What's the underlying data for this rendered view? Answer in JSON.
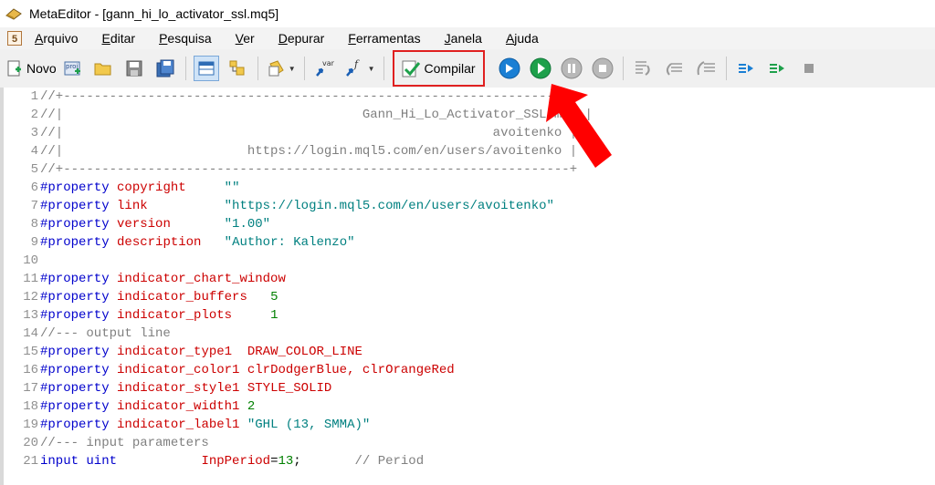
{
  "window": {
    "title": "MetaEditor - [gann_hi_lo_activator_ssl.mq5]"
  },
  "menu": [
    {
      "label": "Arquivo",
      "key": "A"
    },
    {
      "label": "Editar",
      "key": "E"
    },
    {
      "label": "Pesquisa",
      "key": "P"
    },
    {
      "label": "Ver",
      "key": "V"
    },
    {
      "label": "Depurar",
      "key": "D"
    },
    {
      "label": "Ferramentas",
      "key": "F"
    },
    {
      "label": "Janela",
      "key": "J"
    },
    {
      "label": "Ajuda",
      "key": "A"
    }
  ],
  "toolbar": {
    "new_label": "Novo",
    "compile_label": "Compilar",
    "var_label": "var",
    "proj_label": "proj"
  },
  "colors": {
    "highlight": "#e02020",
    "accent_green": "#1ea04b",
    "accent_blue": "#1a7fd4"
  },
  "code_lines": [
    {
      "n": "1",
      "parts": [
        [
          "c-comment",
          "//+------------------------------------------------------------------+"
        ]
      ]
    },
    {
      "n": "2",
      "parts": [
        [
          "c-comment",
          "//|                                       Gann_Hi_Lo_Activator_SSL.mq5 |"
        ]
      ]
    },
    {
      "n": "3",
      "parts": [
        [
          "c-comment",
          "//|                                                        avoitenko |"
        ]
      ]
    },
    {
      "n": "4",
      "parts": [
        [
          "c-comment",
          "//|                        https://login.mql5.com/en/users/avoitenko |"
        ]
      ]
    },
    {
      "n": "5",
      "parts": [
        [
          "c-comment",
          "//+------------------------------------------------------------------+"
        ]
      ]
    },
    {
      "n": "6",
      "parts": [
        [
          "c-kw",
          "#property"
        ],
        [
          "c-plain",
          " "
        ],
        [
          "c-prop",
          "copyright"
        ],
        [
          "c-plain",
          "     "
        ],
        [
          "c-str",
          "\"\""
        ]
      ]
    },
    {
      "n": "7",
      "parts": [
        [
          "c-kw",
          "#property"
        ],
        [
          "c-plain",
          " "
        ],
        [
          "c-prop",
          "link"
        ],
        [
          "c-plain",
          "          "
        ],
        [
          "c-str",
          "\"https://login.mql5.com/en/users/avoitenko\""
        ]
      ]
    },
    {
      "n": "8",
      "parts": [
        [
          "c-kw",
          "#property"
        ],
        [
          "c-plain",
          " "
        ],
        [
          "c-prop",
          "version"
        ],
        [
          "c-plain",
          "       "
        ],
        [
          "c-str",
          "\"1.00\""
        ]
      ]
    },
    {
      "n": "9",
      "parts": [
        [
          "c-kw",
          "#property"
        ],
        [
          "c-plain",
          " "
        ],
        [
          "c-prop",
          "description"
        ],
        [
          "c-plain",
          "   "
        ],
        [
          "c-str",
          "\"Author: Kalenzo\""
        ]
      ]
    },
    {
      "n": "10",
      "parts": []
    },
    {
      "n": "11",
      "parts": [
        [
          "c-kw",
          "#property"
        ],
        [
          "c-plain",
          " "
        ],
        [
          "c-prop",
          "indicator_chart_window"
        ]
      ]
    },
    {
      "n": "12",
      "parts": [
        [
          "c-kw",
          "#property"
        ],
        [
          "c-plain",
          " "
        ],
        [
          "c-prop",
          "indicator_buffers"
        ],
        [
          "c-plain",
          "   "
        ],
        [
          "c-num",
          "5"
        ]
      ]
    },
    {
      "n": "13",
      "parts": [
        [
          "c-kw",
          "#property"
        ],
        [
          "c-plain",
          " "
        ],
        [
          "c-prop",
          "indicator_plots"
        ],
        [
          "c-plain",
          "     "
        ],
        [
          "c-num",
          "1"
        ]
      ]
    },
    {
      "n": "14",
      "parts": [
        [
          "c-comment",
          "//--- output line"
        ]
      ]
    },
    {
      "n": "15",
      "parts": [
        [
          "c-kw",
          "#property"
        ],
        [
          "c-plain",
          " "
        ],
        [
          "c-prop",
          "indicator_type1"
        ],
        [
          "c-plain",
          "  "
        ],
        [
          "c-prop",
          "DRAW_COLOR_LINE"
        ]
      ]
    },
    {
      "n": "16",
      "parts": [
        [
          "c-kw",
          "#property"
        ],
        [
          "c-plain",
          " "
        ],
        [
          "c-prop",
          "indicator_color1"
        ],
        [
          "c-plain",
          " "
        ],
        [
          "c-prop",
          "clrDodgerBlue, clrOrangeRed"
        ]
      ]
    },
    {
      "n": "17",
      "parts": [
        [
          "c-kw",
          "#property"
        ],
        [
          "c-plain",
          " "
        ],
        [
          "c-prop",
          "indicator_style1"
        ],
        [
          "c-plain",
          " "
        ],
        [
          "c-prop",
          "STYLE_SOLID"
        ]
      ]
    },
    {
      "n": "18",
      "parts": [
        [
          "c-kw",
          "#property"
        ],
        [
          "c-plain",
          " "
        ],
        [
          "c-prop",
          "indicator_width1"
        ],
        [
          "c-plain",
          " "
        ],
        [
          "c-num",
          "2"
        ]
      ]
    },
    {
      "n": "19",
      "parts": [
        [
          "c-kw",
          "#property"
        ],
        [
          "c-plain",
          " "
        ],
        [
          "c-prop",
          "indicator_label1"
        ],
        [
          "c-plain",
          " "
        ],
        [
          "c-str",
          "\"GHL (13, SMMA)\""
        ]
      ]
    },
    {
      "n": "20",
      "parts": [
        [
          "c-comment",
          "//--- input parameters"
        ]
      ]
    },
    {
      "n": "21",
      "parts": [
        [
          "c-kw",
          "input uint"
        ],
        [
          "c-plain",
          "           "
        ],
        [
          "c-prop",
          "InpPeriod"
        ],
        [
          "c-plain",
          "="
        ],
        [
          "c-num",
          "13"
        ],
        [
          "c-plain",
          ";       "
        ],
        [
          "c-comment",
          "// Period"
        ]
      ]
    }
  ]
}
